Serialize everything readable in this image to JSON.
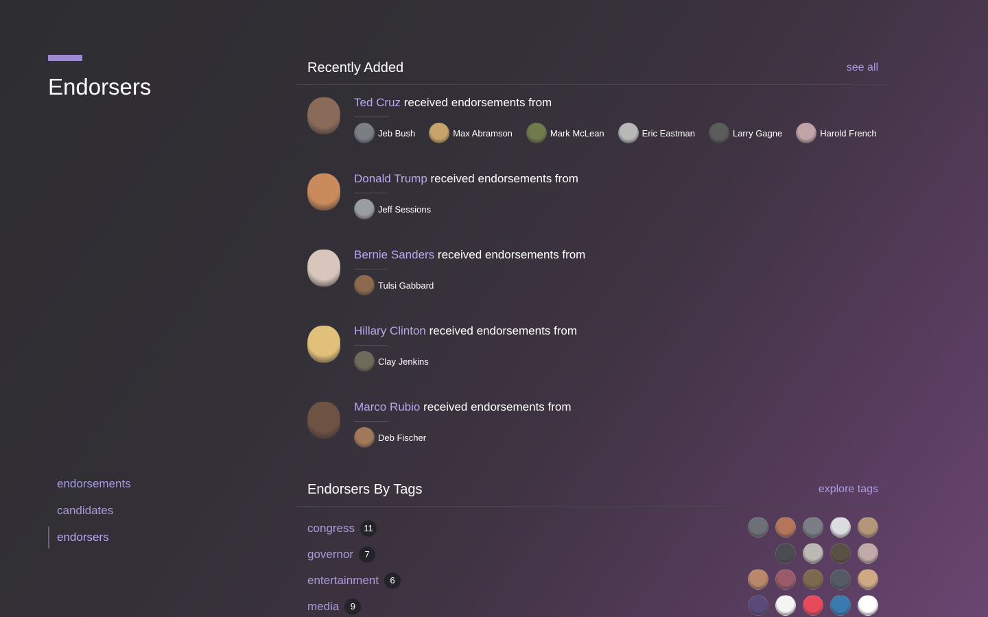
{
  "sidebar": {
    "title": "Endorsers",
    "nav": [
      {
        "label": "endorsements"
      },
      {
        "label": "candidates"
      },
      {
        "label": "endorsers",
        "active": true
      }
    ]
  },
  "recent": {
    "title": "Recently Added",
    "link": "see all",
    "suffix": " received endorsements from",
    "entries": [
      {
        "candidate": "Ted Cruz",
        "face_color": "#8a6a58",
        "endorsers": [
          {
            "name": "Jeb Bush",
            "color": "#7c7e86"
          },
          {
            "name": "Max Abramson",
            "color": "#c9a46a"
          },
          {
            "name": "Mark McLean",
            "color": "#6f7a4d"
          },
          {
            "name": "Eric Eastman",
            "color": "#b8b8b8"
          },
          {
            "name": "Larry Gagne",
            "color": "#5c5c5c"
          },
          {
            "name": "Harold French",
            "color": "#c0a4a8"
          }
        ]
      },
      {
        "candidate": "Donald Trump",
        "face_color": "#c98a5c",
        "endorsers": [
          {
            "name": "Jeff Sessions",
            "color": "#9a9da2"
          }
        ]
      },
      {
        "candidate": "Bernie Sanders",
        "face_color": "#d8c6bc",
        "endorsers": [
          {
            "name": "Tulsi Gabbard",
            "color": "#8d6a4e"
          }
        ]
      },
      {
        "candidate": "Hillary Clinton",
        "face_color": "#e1c07a",
        "endorsers": [
          {
            "name": "Clay Jenkins",
            "color": "#6f6a5c"
          }
        ]
      },
      {
        "candidate": "Marco Rubio",
        "face_color": "#6e5244",
        "endorsers": [
          {
            "name": "Deb Fischer",
            "color": "#a0785a"
          }
        ]
      }
    ]
  },
  "tags": {
    "title": "Endorsers By Tags",
    "link": "explore tags",
    "items": [
      {
        "name": "congress",
        "count": "11",
        "avatars": [
          "#6d7078",
          "#b5755a",
          "#7a7f86",
          "#dcdde0",
          "#b59678"
        ]
      },
      {
        "name": "governor",
        "count": "7",
        "avatars": [
          "#4b4c52",
          "#bcb8b4",
          "#5a5046",
          "#c2aaa8"
        ]
      },
      {
        "name": "entertainment",
        "count": "6",
        "avatars": [
          "#b9876a",
          "#9a5a6a",
          "#7d6a4e",
          "#555a66",
          "#d0a884"
        ]
      },
      {
        "name": "media",
        "count": "9",
        "avatars": [
          "#5a4a7a",
          "#f4f4f4",
          "#e84a5a",
          "#3a7ab0",
          "#ffffff"
        ]
      }
    ]
  }
}
